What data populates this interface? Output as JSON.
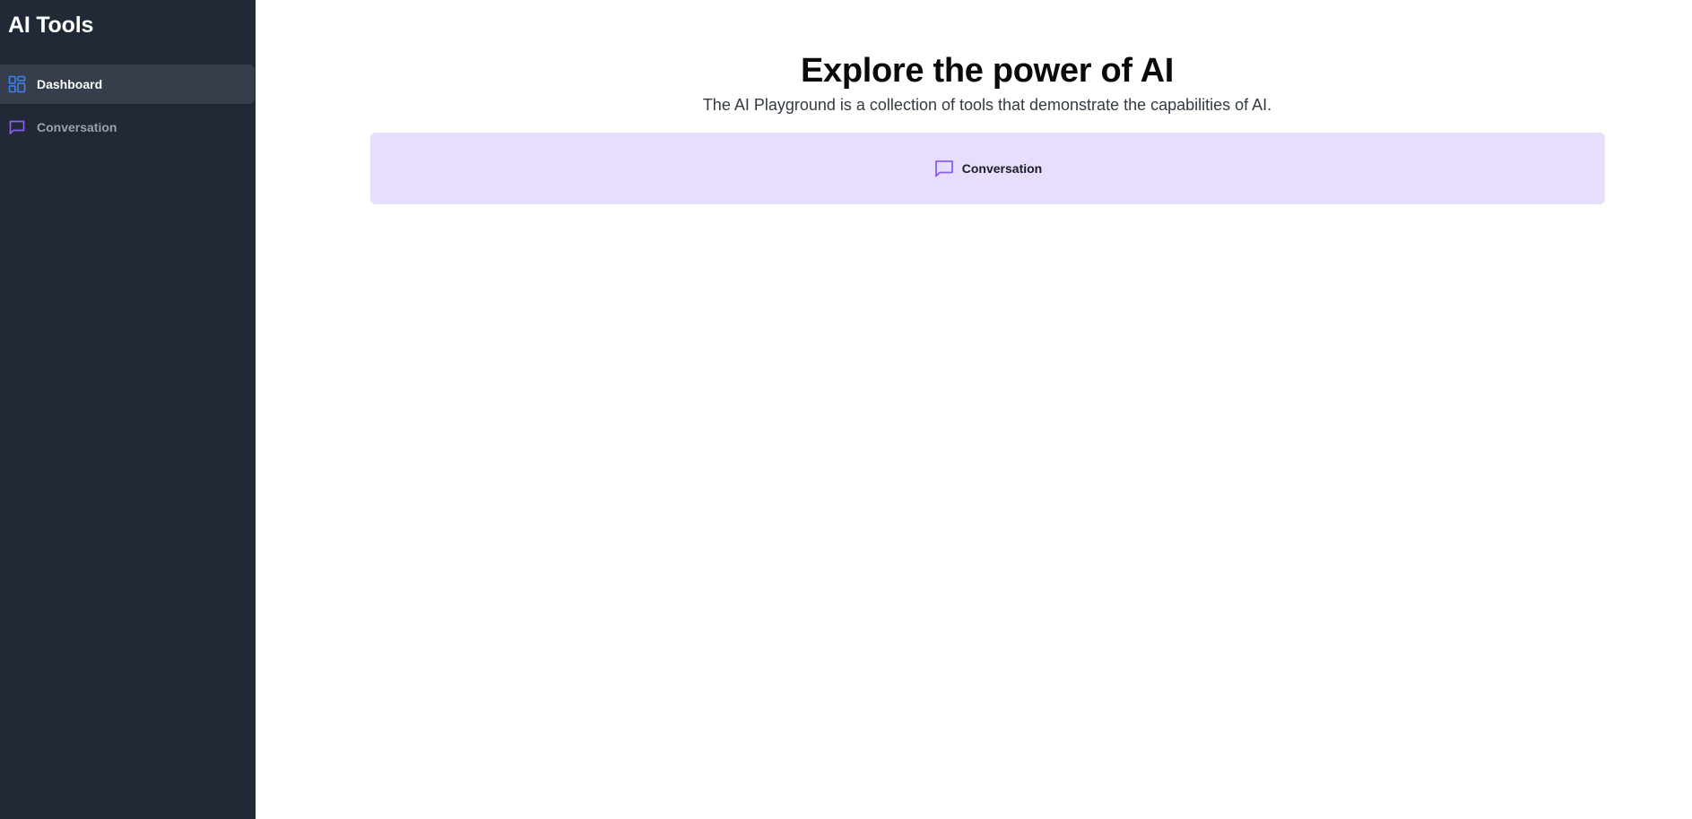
{
  "sidebar": {
    "brand": "AI Tools",
    "items": [
      {
        "label": "Dashboard",
        "icon": "dashboard-grid-icon",
        "active": true,
        "icon_color": "#3b82f6"
      },
      {
        "label": "Conversation",
        "icon": "message-square-icon",
        "active": false,
        "icon_color": "#8b5cf6"
      }
    ]
  },
  "main": {
    "title": "Explore the power of AI",
    "subtitle": "The AI Playground is a collection of tools that demonstrate the capabilities of AI.",
    "tools": [
      {
        "label": "Conversation",
        "icon": "message-square-icon",
        "icon_color": "#8b5cf6",
        "background": "#e7defd"
      }
    ]
  },
  "colors": {
    "sidebar_bg": "#212936",
    "active_item_bg": "#363e4b"
  }
}
